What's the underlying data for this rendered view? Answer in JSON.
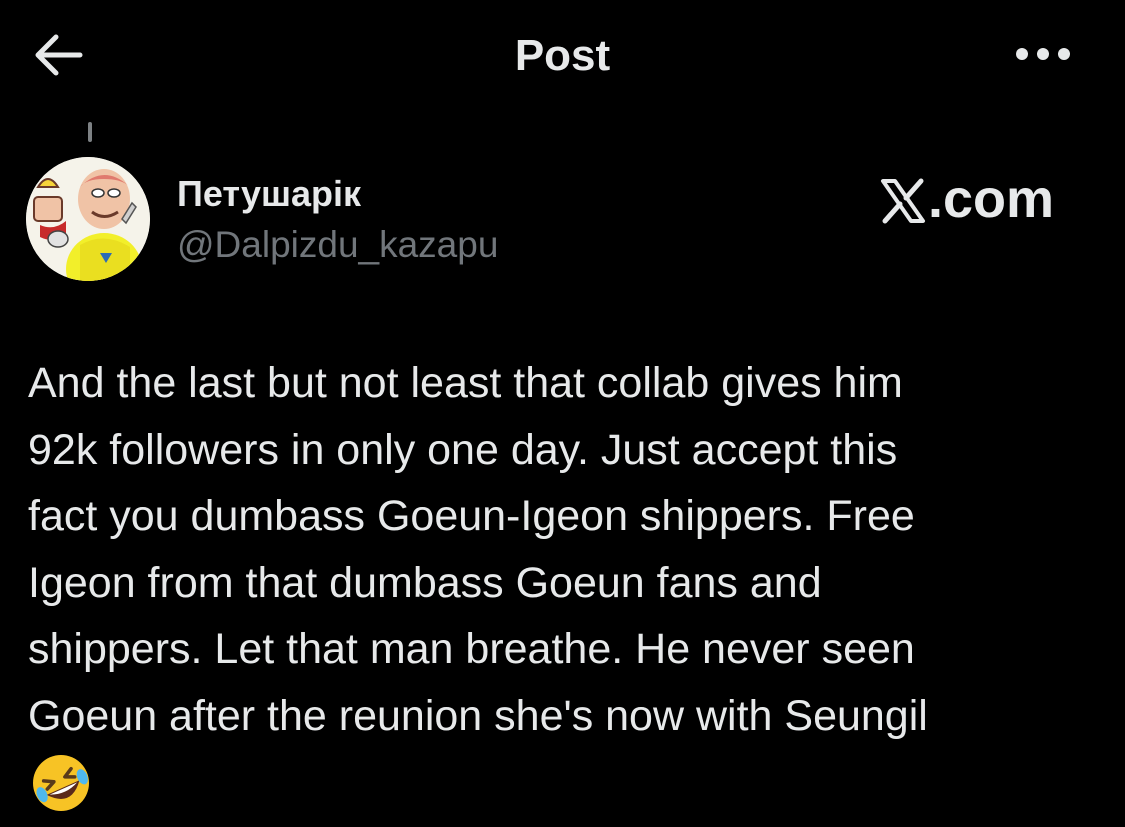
{
  "header": {
    "title": "Post",
    "back_icon": "arrow-left-icon",
    "more_icon": "more-horizontal-icon"
  },
  "post": {
    "author": {
      "display_name": "Петушарік",
      "handle": "@Dalpizdu_kazapu",
      "avatar_icon": "cartoon-avatar"
    },
    "watermark": {
      "text": ".com",
      "logo_icon": "x-logo-icon"
    },
    "text": "And the last but not least that collab gives him\n92k followers in only one day. Just accept this\nfact  you dumbass Goeun-Igeon shippers. Free\nIgeon from that dumbass Goeun fans and\nshippers. Let that man breathe. He never seen\nGoeun after the reunion she's now with Seungil",
    "emoji_icon": "rolling-on-floor-laughing-emoji"
  },
  "colors": {
    "background": "#000000",
    "primary_text": "#e7e9ea",
    "secondary_text": "#71767b"
  }
}
